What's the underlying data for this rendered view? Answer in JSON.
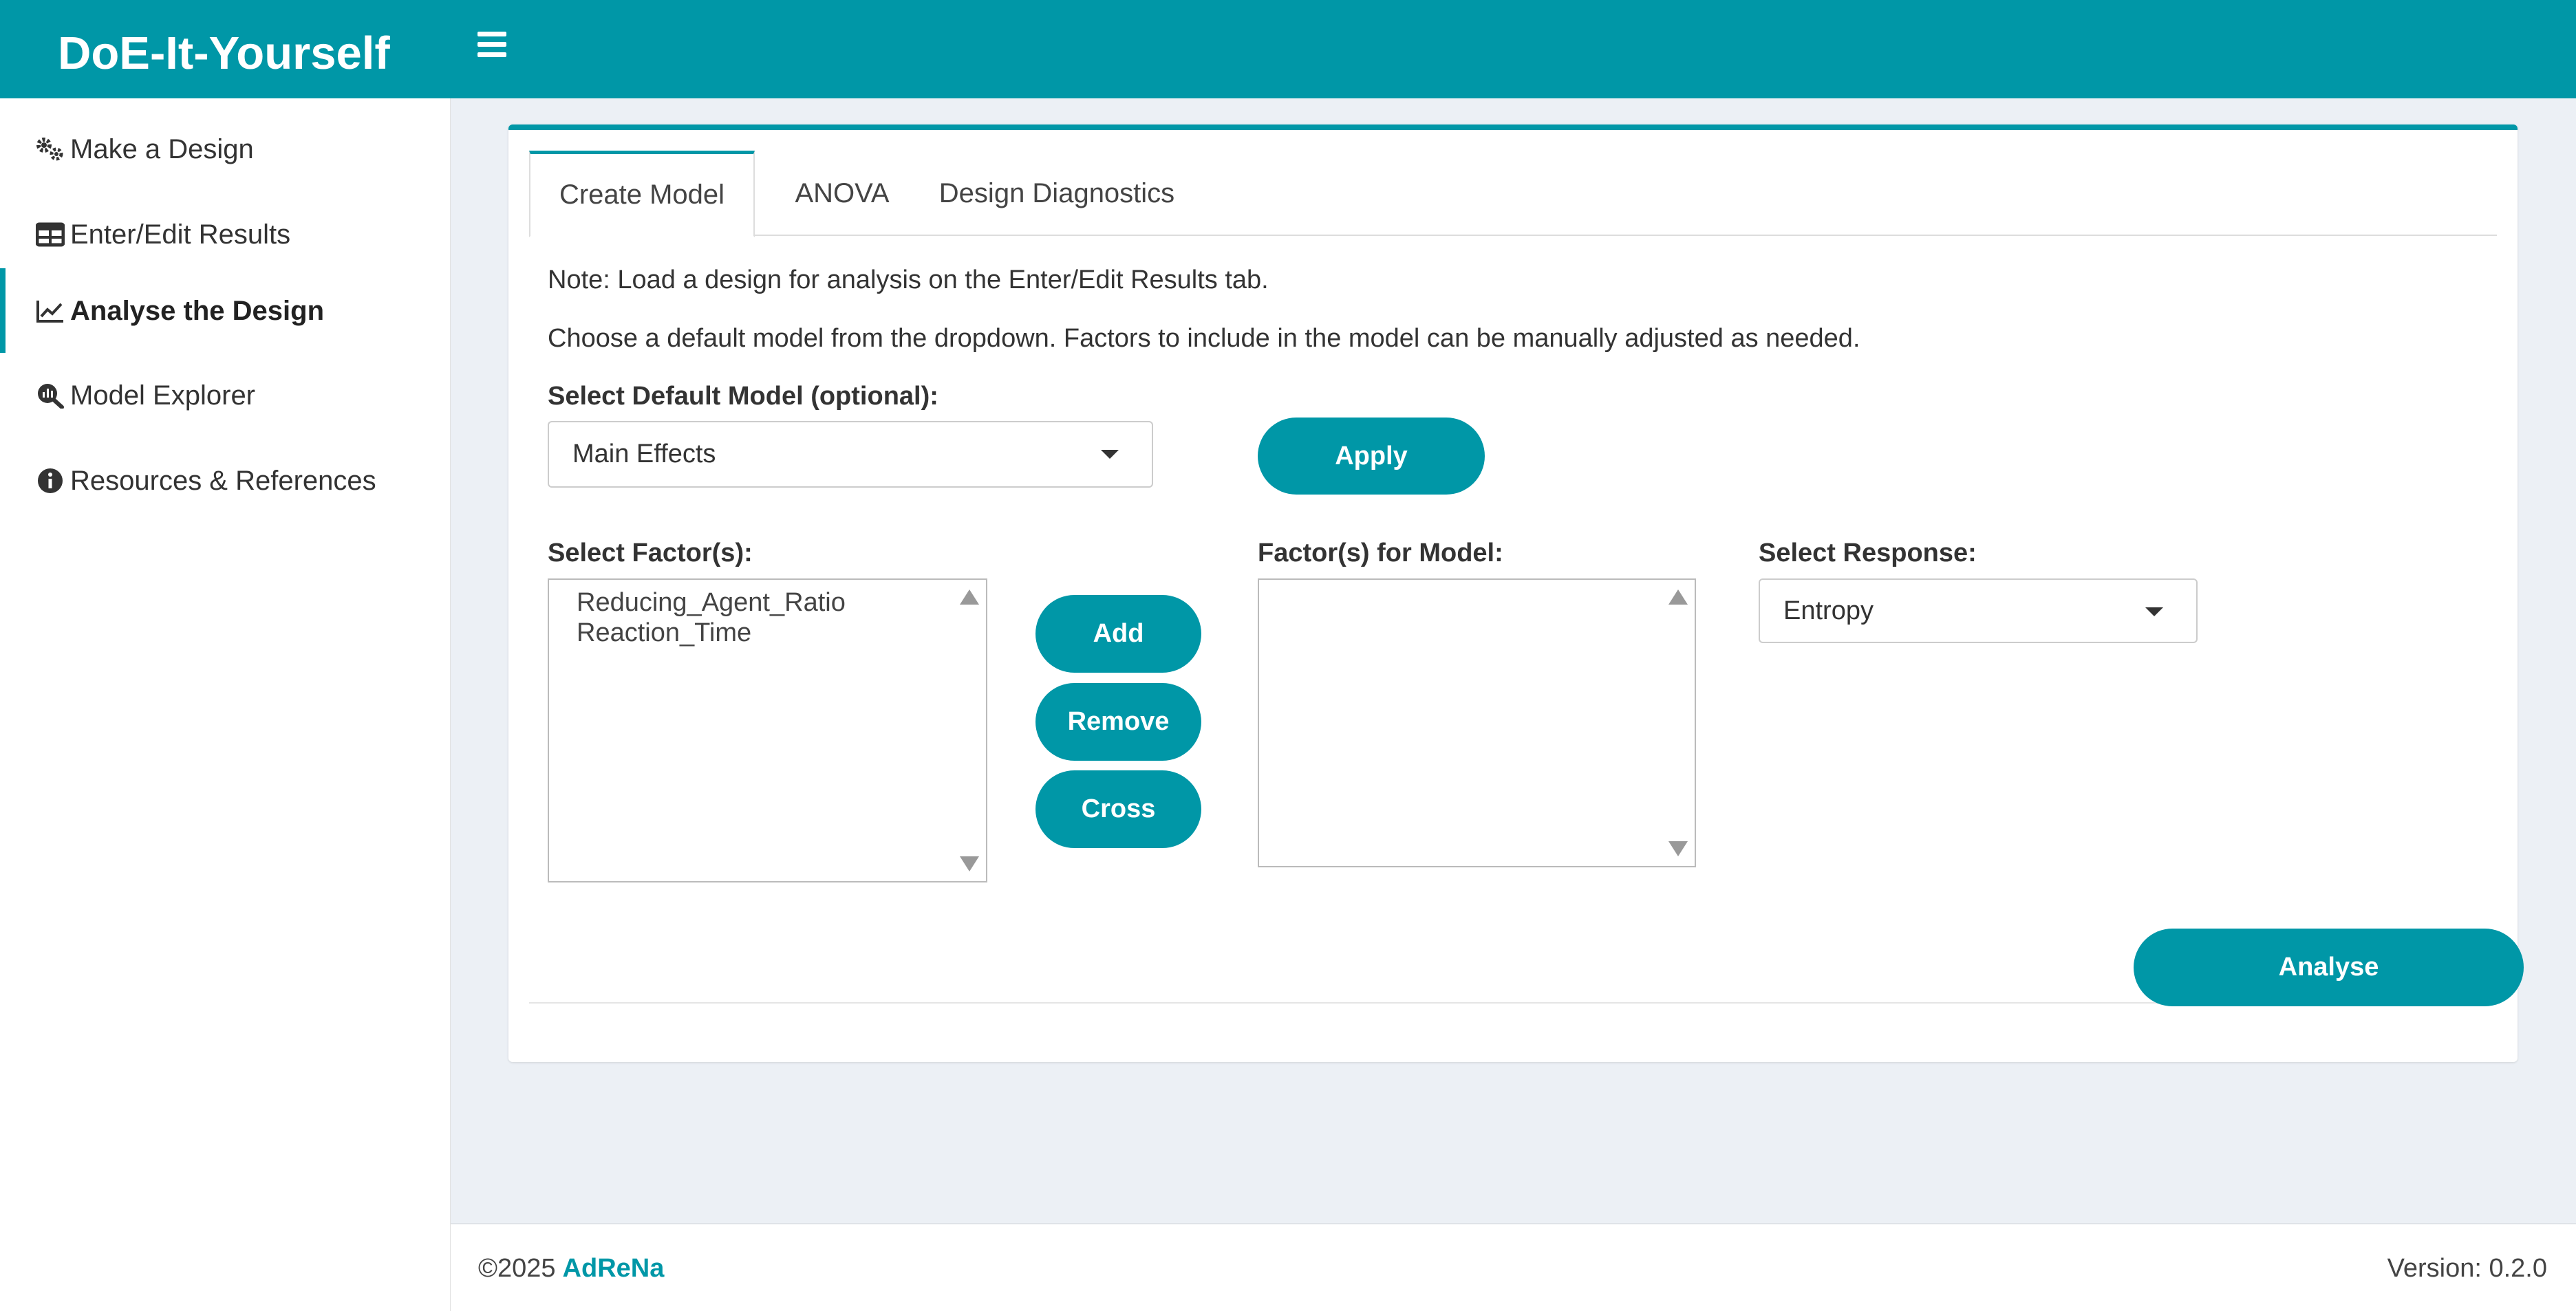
{
  "header": {
    "title": "DoE-It-Yourself"
  },
  "sidebar": {
    "items": [
      {
        "label": "Make a Design",
        "icon": "gears-icon"
      },
      {
        "label": "Enter/Edit Results",
        "icon": "table-icon"
      },
      {
        "label": "Analyse the Design",
        "icon": "line-chart-icon",
        "active": true
      },
      {
        "label": "Model Explorer",
        "icon": "search-chart-icon"
      },
      {
        "label": "Resources & References",
        "icon": "info-circle-icon"
      }
    ]
  },
  "tabs": [
    {
      "label": "Create Model",
      "active": true
    },
    {
      "label": "ANOVA"
    },
    {
      "label": "Design Diagnostics"
    }
  ],
  "create_model": {
    "note": "Note: Load a design for analysis on the Enter/Edit Results tab.",
    "instructions": "Choose a default model from the dropdown. Factors to include in the model can be manually adjusted as needed.",
    "default_model_label": "Select Default Model (optional):",
    "default_model_value": "Main Effects",
    "apply_label": "Apply",
    "select_factors_label": "Select Factor(s):",
    "factors": [
      "Reducing_Agent_Ratio",
      "Reaction_Time"
    ],
    "add_label": "Add",
    "remove_label": "Remove",
    "cross_label": "Cross",
    "model_factors_label": "Factor(s) for Model:",
    "model_factors": [],
    "response_label": "Select Response:",
    "response_value": "Entropy",
    "analyse_label": "Analyse"
  },
  "footer": {
    "copyright": "©2025",
    "org": "AdReNa",
    "version": "Version: 0.2.0"
  },
  "colors": {
    "accent": "#0097a7",
    "background": "#ecf0f5"
  }
}
